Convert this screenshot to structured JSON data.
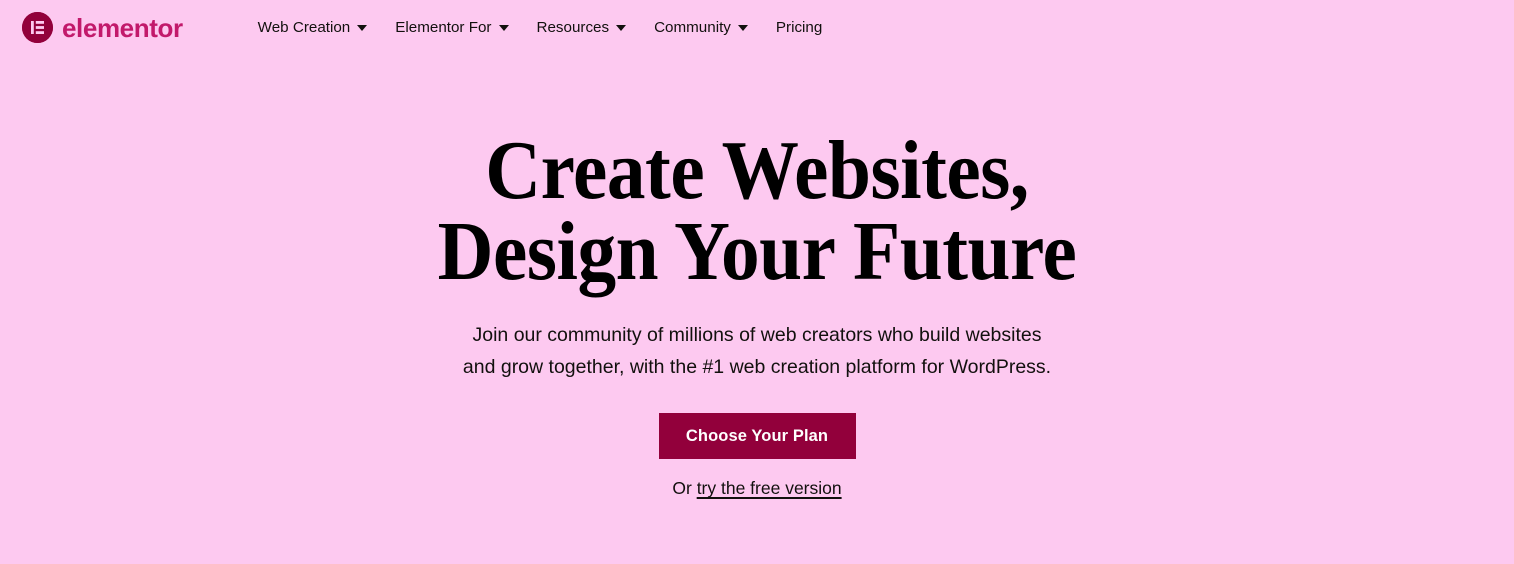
{
  "theme": {
    "background": "#fdc9f0",
    "brand_crimson": "#c2196b",
    "brand_dark": "#92003b",
    "text_dark": "#12100e",
    "button_text": "#ffffff"
  },
  "header": {
    "logo": {
      "icon": "elementor-badge-icon",
      "wordmark": "elementor"
    },
    "nav": [
      {
        "label": "Web Creation",
        "has_dropdown": true
      },
      {
        "label": "Elementor For",
        "has_dropdown": true
      },
      {
        "label": "Resources",
        "has_dropdown": true
      },
      {
        "label": "Community",
        "has_dropdown": true
      },
      {
        "label": "Pricing",
        "has_dropdown": false
      }
    ]
  },
  "hero": {
    "title_line_1": "Create Websites,",
    "title_line_2": "Design Your Future",
    "subtitle_line_1": "Join our community of millions of web creators who build websites",
    "subtitle_line_2": "and grow together, with the #1 web creation platform for WordPress.",
    "cta_label": "Choose Your Plan",
    "secondary_prefix": "Or ",
    "secondary_link": "try the free version"
  }
}
